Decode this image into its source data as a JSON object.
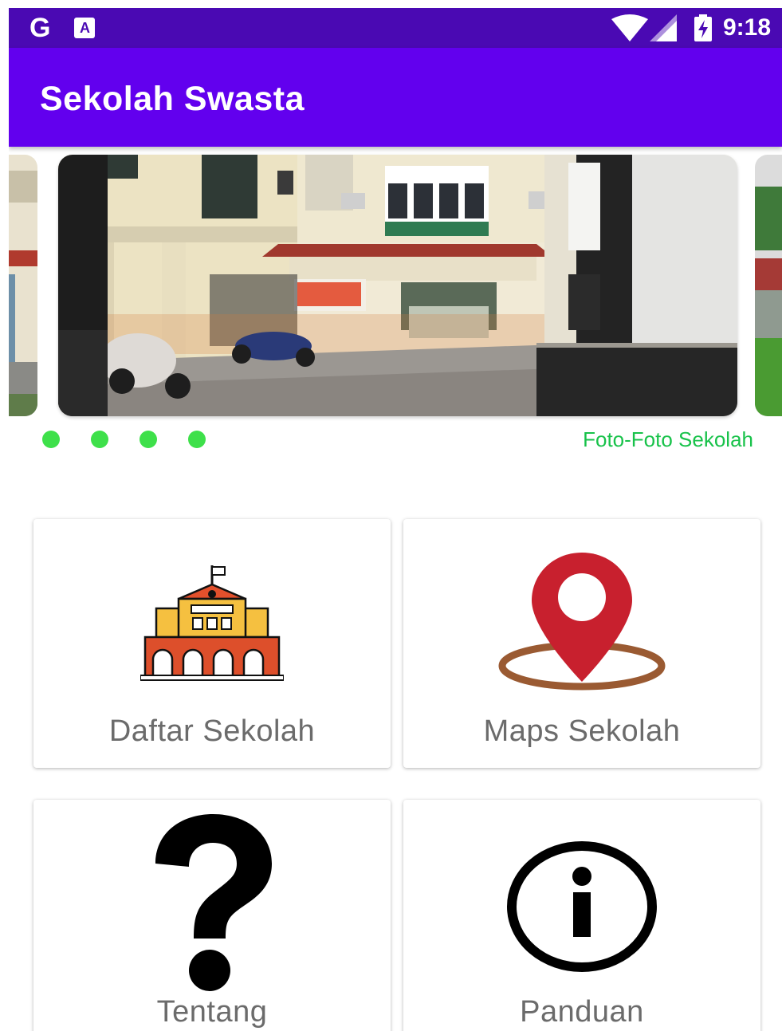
{
  "status_bar": {
    "left_icons": [
      "google-icon",
      "translate-icon"
    ],
    "google_glyph": "G",
    "translate_glyph": "A",
    "right_icons": [
      "wifi-icon",
      "signal-icon",
      "battery-charging-icon"
    ],
    "time": "9:18"
  },
  "app_bar": {
    "title": "Sekolah Swasta"
  },
  "carousel": {
    "dots": 4,
    "caption": "Foto-Foto Sekolah",
    "dot_color": "#3ee04a",
    "caption_color": "#18c24a"
  },
  "menu": [
    {
      "label": "Daftar Sekolah",
      "icon": "school-building-icon"
    },
    {
      "label": "Maps Sekolah",
      "icon": "map-pin-icon"
    },
    {
      "label": "Tentang",
      "icon": "question-mark-icon"
    },
    {
      "label": "Panduan",
      "icon": "info-icon"
    }
  ],
  "colors": {
    "status_bar": "#4a09b3",
    "app_bar": "#6200ee",
    "card_label": "#6b6b6b",
    "pin_red": "#c8202e",
    "ring_brown": "#9a5a32"
  }
}
